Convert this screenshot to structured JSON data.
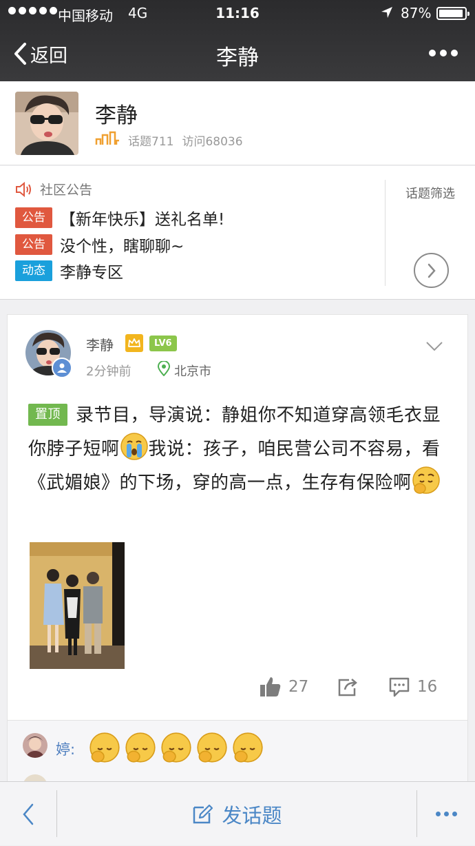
{
  "status_bar": {
    "carrier": "中国移动",
    "network": "4G",
    "time": "11:16",
    "battery": "87%",
    "battery_level": 0.87,
    "icons": [
      "signal-dots-icon",
      "location-arrow-icon",
      "battery-icon"
    ]
  },
  "nav": {
    "back_label": "返回",
    "title": "李静",
    "more_icon": "more-dots-icon"
  },
  "profile": {
    "name": "李静",
    "topics": "话题711",
    "visits": "访问68036",
    "level_icon": "level-bars-icon"
  },
  "notice": {
    "header": "社区公告",
    "header_icon": "speaker-icon",
    "items": [
      {
        "tag": "公告",
        "text": "【新年快乐】送礼名单!"
      },
      {
        "tag": "公告",
        "text": "没个性，瞎聊聊~"
      },
      {
        "tag": "动态",
        "text": "李静专区"
      }
    ],
    "filter_label": "话题筛选",
    "arrow_icon": "chevron-right-circle-icon"
  },
  "post": {
    "author": "李静",
    "level": "LV6",
    "time": "2分钟前",
    "location": "北京市",
    "pinned_tag": "置顶",
    "text_part1": "录节目，导演说：静姐你不知道穿高领毛衣显你脖子短啊",
    "text_part2": "我说：孩子，咱民营公司不容易，看《武媚娘》的下场，穿的高一点，生存有保险啊",
    "likes": "27",
    "comments": "16",
    "icons": [
      "crown-icon",
      "location-pin-icon",
      "chevron-down-icon",
      "thumbs-up-icon",
      "share-icon",
      "comment-icon",
      "crying-emoji-icon",
      "shy-emoji-icon"
    ]
  },
  "comment": {
    "name": "婷:",
    "emoji_count": 5
  },
  "bottom_bar": {
    "post_label": "发话题",
    "icons": [
      "back-chevron-icon",
      "compose-icon",
      "more-dots-icon"
    ]
  },
  "colors": {
    "nav_bg": "#2b2b2d",
    "notice_tag": "#e0583f",
    "dynamic_tag": "#1aa0dc",
    "pinned_tag": "#72b84f",
    "level_badge": "#8cc64b",
    "crown": "#f2b51e",
    "link_blue": "#4b87c6"
  }
}
